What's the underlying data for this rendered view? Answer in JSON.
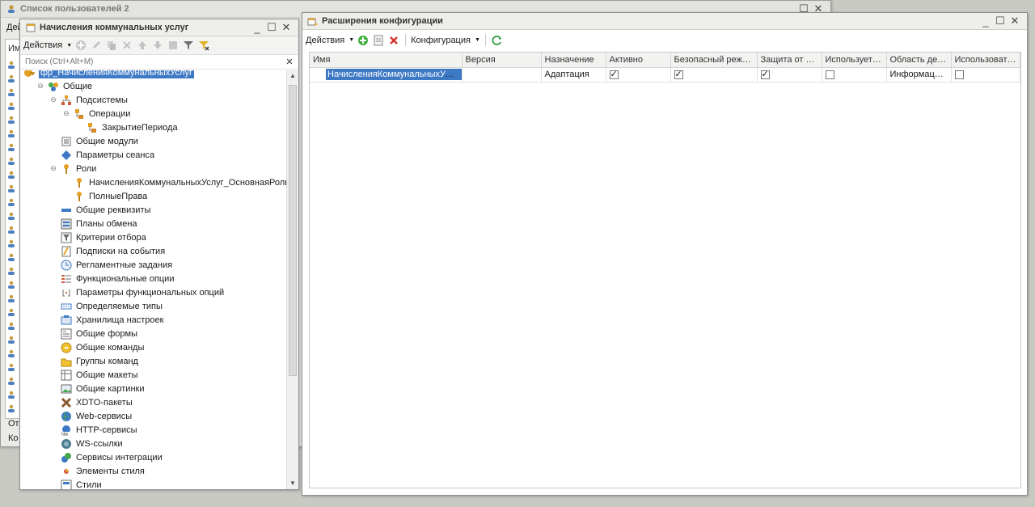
{
  "bg_window": {
    "title": "Список пользователей 2",
    "toolbar_fragment": "Дей",
    "header_fragment": "Им",
    "footer_fragment_1": "Отв",
    "footer_fragment_2": "Ко"
  },
  "tree_window": {
    "title": "Начисления коммунальных услуг",
    "actions_label": "Действия",
    "search_placeholder": "Поиск (Ctrl+Alt+M)",
    "items": [
      {
        "label": "фр_НачисленияКоммунальныхУслуг",
        "level": 0,
        "icon": "config-icon",
        "selected": true
      },
      {
        "label": "Общие",
        "level": 1,
        "icon": "common-icon",
        "toggle": "minus"
      },
      {
        "label": "Подсистемы",
        "level": 2,
        "icon": "subsystems-icon",
        "toggle": "minus"
      },
      {
        "label": "Операции",
        "level": 3,
        "icon": "subsystem-icon",
        "toggle": "minus"
      },
      {
        "label": "ЗакрытиеПериода",
        "level": 4,
        "icon": "subsystem-icon"
      },
      {
        "label": "Общие модули",
        "level": 2,
        "icon": "module-icon"
      },
      {
        "label": "Параметры сеанса",
        "level": 2,
        "icon": "session-params-icon"
      },
      {
        "label": "Роли",
        "level": 2,
        "icon": "role-icon",
        "toggle": "minus"
      },
      {
        "label": "НачисленияКоммунальныхУслуг_ОсновнаяРоль",
        "level": 3,
        "icon": "role-icon"
      },
      {
        "label": "ПолныеПрава",
        "level": 3,
        "icon": "role-icon"
      },
      {
        "label": "Общие реквизиты",
        "level": 2,
        "icon": "attribute-icon"
      },
      {
        "label": "Планы обмена",
        "level": 2,
        "icon": "exchange-plan-icon"
      },
      {
        "label": "Критерии отбора",
        "level": 2,
        "icon": "filter-criteria-icon"
      },
      {
        "label": "Подписки на события",
        "level": 2,
        "icon": "event-subscription-icon"
      },
      {
        "label": "Регламентные задания",
        "level": 2,
        "icon": "scheduled-job-icon"
      },
      {
        "label": "Функциональные опции",
        "level": 2,
        "icon": "functional-option-icon"
      },
      {
        "label": "Параметры функциональных опций",
        "level": 2,
        "icon": "fo-params-icon"
      },
      {
        "label": "Определяемые типы",
        "level": 2,
        "icon": "defined-type-icon"
      },
      {
        "label": "Хранилища настроек",
        "level": 2,
        "icon": "settings-storage-icon"
      },
      {
        "label": "Общие формы",
        "level": 2,
        "icon": "form-icon"
      },
      {
        "label": "Общие команды",
        "level": 2,
        "icon": "command-icon"
      },
      {
        "label": "Группы команд",
        "level": 2,
        "icon": "command-group-icon"
      },
      {
        "label": "Общие макеты",
        "level": 2,
        "icon": "template-icon"
      },
      {
        "label": "Общие картинки",
        "level": 2,
        "icon": "picture-icon"
      },
      {
        "label": "XDTO-пакеты",
        "level": 2,
        "icon": "xdto-icon"
      },
      {
        "label": "Web-сервисы",
        "level": 2,
        "icon": "web-service-icon"
      },
      {
        "label": "HTTP-сервисы",
        "level": 2,
        "icon": "http-service-icon"
      },
      {
        "label": "WS-ссылки",
        "level": 2,
        "icon": "ws-link-icon"
      },
      {
        "label": "Сервисы интеграции",
        "level": 2,
        "icon": "integration-service-icon"
      },
      {
        "label": "Элементы стиля",
        "level": 2,
        "icon": "style-element-icon"
      },
      {
        "label": "Стили",
        "level": 2,
        "icon": "style-icon"
      }
    ]
  },
  "ext_window": {
    "title": "Расширения конфигурации",
    "actions_label": "Действия",
    "config_label": "Конфигурация",
    "columns": [
      "Имя",
      "Версия",
      "Назначение",
      "Активно",
      "Безопасный режим, ...",
      "Защита от опа...",
      "Используется ...",
      "Область дейст...",
      "Использовать ..."
    ],
    "rows": [
      {
        "name": "НачисленияКоммунальныхУслуг",
        "version": "",
        "purpose": "Адаптация",
        "active": true,
        "safe_mode": true,
        "protection": true,
        "used": false,
        "scope": "Информацион...",
        "use": false
      }
    ]
  }
}
